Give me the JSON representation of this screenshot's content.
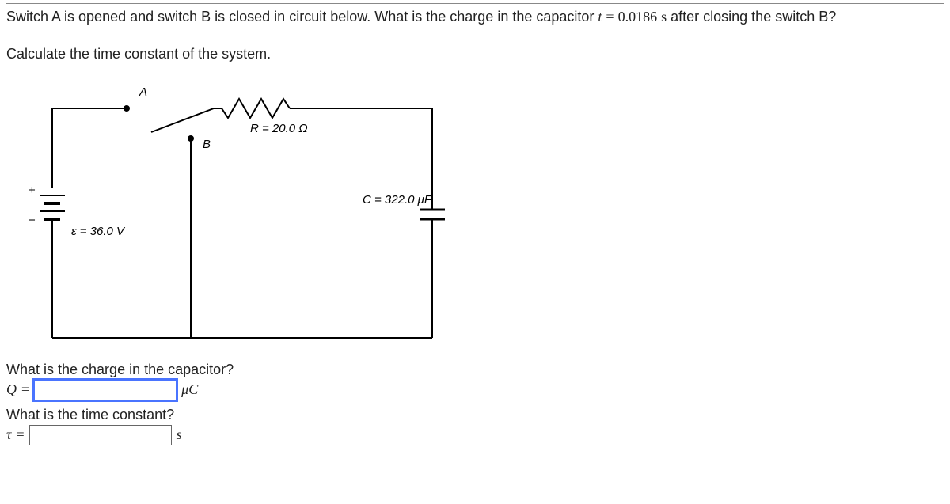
{
  "question": {
    "main_pre": "Switch A is opened and switch B is closed in circuit below. What is the charge in the capacitor ",
    "var_t": "t",
    "eq": "=",
    "t_value": "0.0186",
    "t_unit": "s",
    "main_post": " after closing the switch B?",
    "sub": "Calculate the time constant of the system."
  },
  "diagram": {
    "A": "A",
    "B": "B",
    "R": "R = 20.0 Ω",
    "C": "C = 322.0 μF",
    "E": "ε = 36.0 V",
    "plus": "+",
    "minus": "−"
  },
  "answers": {
    "q_label": "What is the charge in the capacitor?",
    "q_sym": "Q",
    "q_eq": "=",
    "q_unit": "μC",
    "tau_label": "What is the time constant?",
    "tau_sym": "τ",
    "tau_eq": "=",
    "tau_unit": "s",
    "q_value": "",
    "tau_value": ""
  }
}
